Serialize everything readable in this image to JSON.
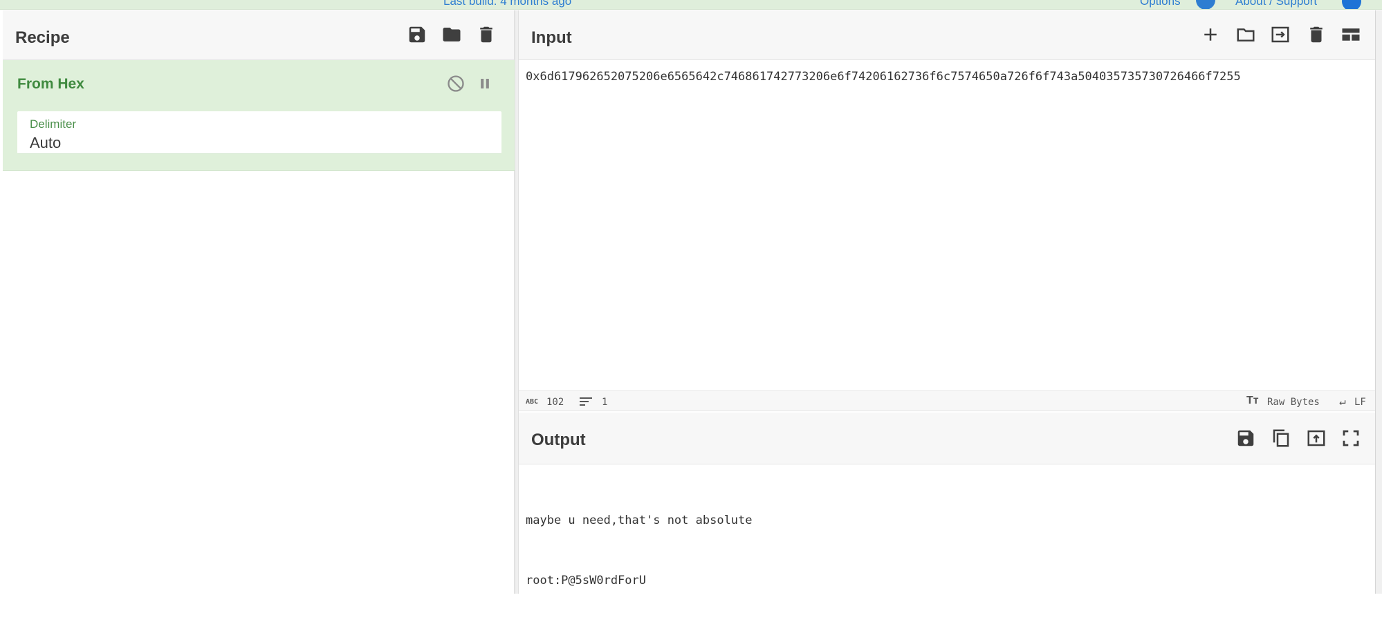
{
  "topbar": {
    "build_text": "Last build: 4 months ago",
    "options_label": "Options",
    "about_label": "About / Support"
  },
  "recipe": {
    "title": "Recipe",
    "icons": [
      "save-icon",
      "folder-icon",
      "trash-icon"
    ],
    "operation": {
      "name": "From Hex",
      "icons": [
        "disable-icon",
        "pause-icon"
      ],
      "field_label": "Delimiter",
      "field_value": "Auto"
    }
  },
  "input": {
    "title": "Input",
    "icons": [
      "plus-icon",
      "folder-icon",
      "import-icon",
      "trash-icon",
      "layout-icon"
    ],
    "value": "0x6d617962652075206e6565642c746861742773206e6f74206162736f6c7574650a726f6f743a504035735730726466f7255",
    "status": {
      "abc_label": "ABC",
      "length": "102",
      "lines": "1",
      "raw_bytes": "Raw Bytes",
      "line_ending": "LF"
    }
  },
  "output": {
    "title": "Output",
    "icons": [
      "save-icon",
      "copy-icon",
      "replace-input-icon",
      "fullscreen-icon"
    ],
    "lines": [
      "maybe u need,that's not absolute",
      "root:P@5sW0rdForU"
    ]
  },
  "colors": {
    "accent": "#3f8a3f",
    "operation_bg": "#dff0da",
    "link": "#2e7dd1"
  }
}
